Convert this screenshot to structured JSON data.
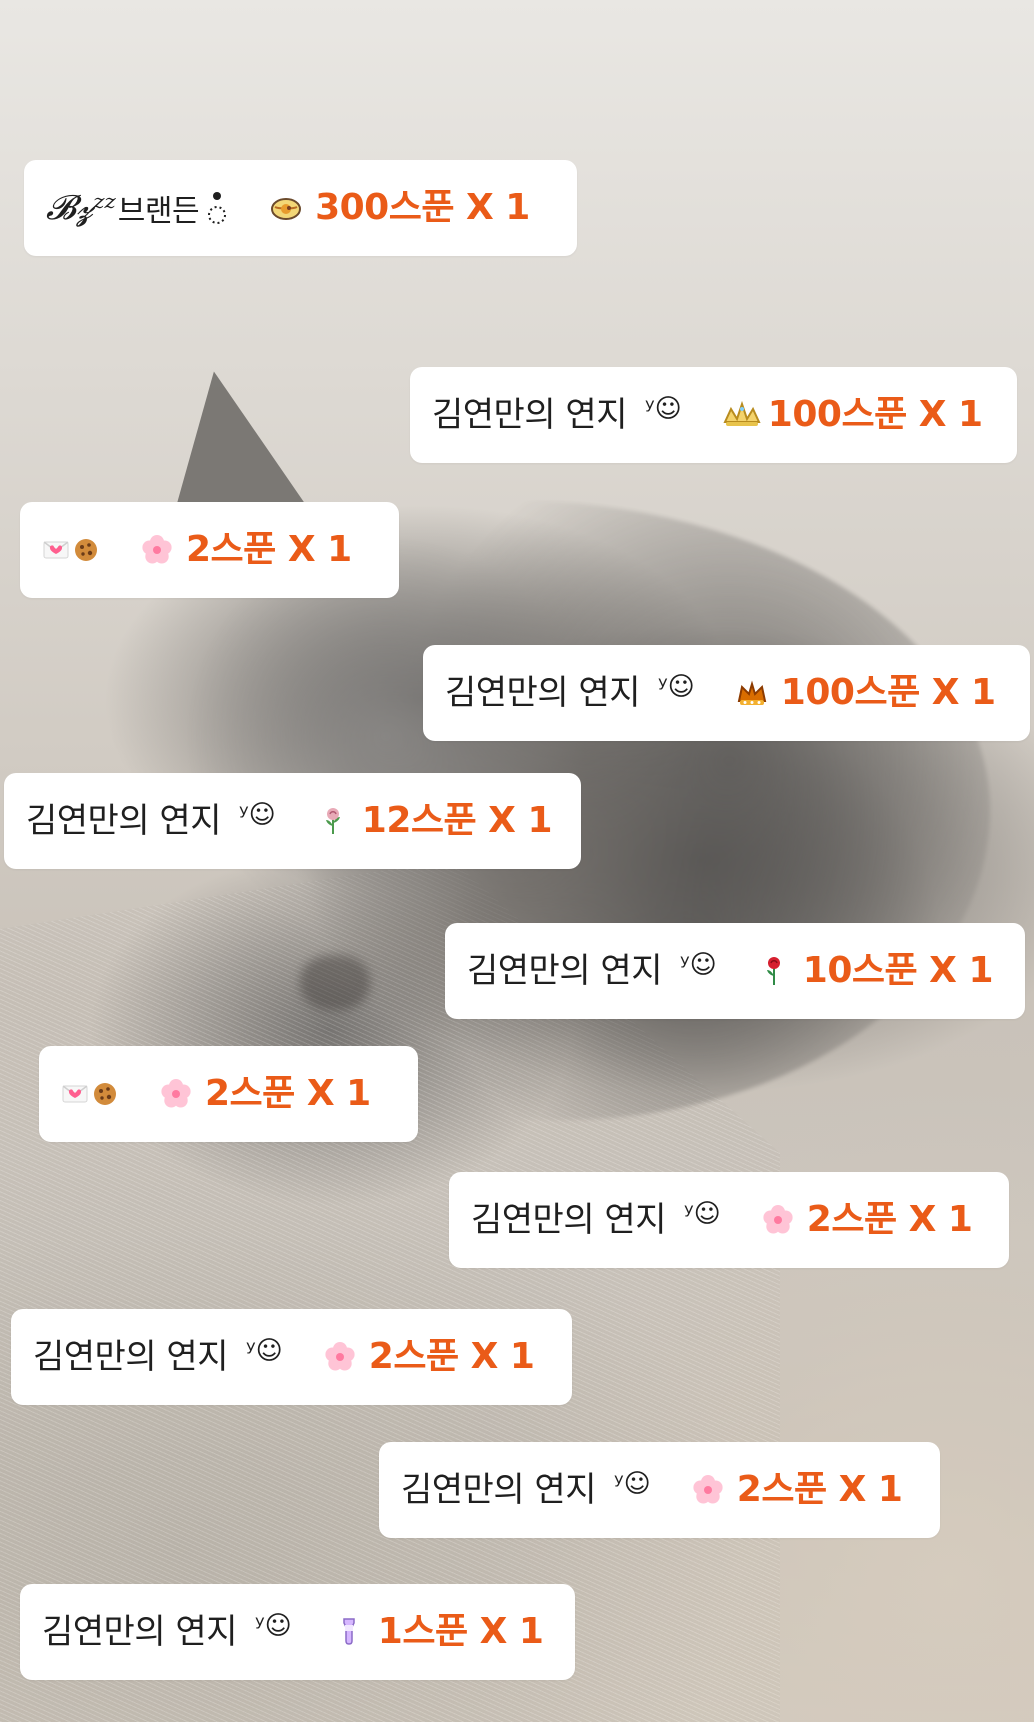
{
  "rows": [
    {
      "name": "𝓑𝔃ᶻᶻ브랜든",
      "icon": "ramen-bowl-icon",
      "amount": "300스푼 X 1"
    },
    {
      "name": "김연만의 연지",
      "sig": "ʸ☺",
      "icon": "tiara-icon",
      "amount": "100스푼 X 1"
    },
    {
      "name": "💌🍪",
      "icon": "cherry-blossom-icon",
      "amount": "2스푼 X 1"
    },
    {
      "name": "김연만의 연지",
      "sig": "ʸ☺",
      "icon": "crown-icon",
      "amount": "100스푼 X 1"
    },
    {
      "name": "김연만의 연지",
      "sig": "ʸ☺",
      "icon": "rose-icon",
      "amount": "12스푼 X 1"
    },
    {
      "name": "김연만의 연지",
      "sig": "ʸ☺",
      "icon": "red-rose-icon",
      "amount": "10스푼 X 1"
    },
    {
      "name": "💌🍪",
      "icon": "cherry-blossom-icon",
      "amount": "2스푼 X 1"
    },
    {
      "name": "김연만의 연지",
      "sig": "ʸ☺",
      "icon": "cherry-blossom-icon",
      "amount": "2스푼 X 1"
    },
    {
      "name": "김연만의 연지",
      "sig": "ʸ☺",
      "icon": "cherry-blossom-icon",
      "amount": "2스푼 X 1"
    },
    {
      "name": "김연만의 연지",
      "sig": "ʸ☺",
      "icon": "cherry-blossom-icon",
      "amount": "2스푼 X 1"
    },
    {
      "name": "김연만의 연지",
      "sig": "ʸ☺",
      "icon": "drink-icon",
      "amount": "1스푼 X 1"
    }
  ]
}
